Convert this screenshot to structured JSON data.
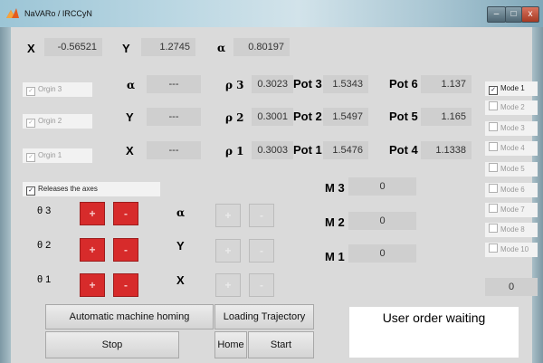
{
  "window": {
    "title": "NaVARo / IRCCyN",
    "minimize": "–",
    "maximize": "□",
    "close": "x"
  },
  "pose": {
    "x_label": "X",
    "x_value": "-0.56521",
    "y_label": "Y",
    "y_value": "1.2745",
    "a_label": "α",
    "a_value": "0.80197"
  },
  "origins": [
    "Orgin 3",
    "Orgin 2",
    "Orgin 1"
  ],
  "targets": [
    {
      "label": "α",
      "value": "---"
    },
    {
      "label": "Y",
      "value": "---"
    },
    {
      "label": "X",
      "value": "---"
    }
  ],
  "rhos": [
    {
      "label": "ρ 3",
      "value": "0.3023"
    },
    {
      "label": "ρ 2",
      "value": "0.3001"
    },
    {
      "label": "ρ 1",
      "value": "0.3003"
    }
  ],
  "pots_left": [
    {
      "label": "Pot 3",
      "value": "1.5343"
    },
    {
      "label": "Pot 2",
      "value": "1.5497"
    },
    {
      "label": "Pot 1",
      "value": "1.5476"
    }
  ],
  "pots_right": [
    {
      "label": "Pot 6",
      "value": "1.137"
    },
    {
      "label": "Pot 5",
      "value": "1.165"
    },
    {
      "label": "Pot 4",
      "value": "1.1338"
    }
  ],
  "release": {
    "label": "Releases the axes",
    "checked": "✓"
  },
  "thetas": [
    {
      "label": "θ 3",
      "axis": "α"
    },
    {
      "label": "θ 2",
      "axis": "Y"
    },
    {
      "label": "θ 1",
      "axis": "X"
    }
  ],
  "plus": "+",
  "minus": "-",
  "motors": [
    {
      "label": "M 3",
      "value": "0"
    },
    {
      "label": "M 2",
      "value": "0"
    },
    {
      "label": "M 1",
      "value": "0"
    }
  ],
  "modes": [
    "Mode 1",
    "Mode 2",
    "Mode 3",
    "Mode 4",
    "Mode 5",
    "Mode 6",
    "Mode 7",
    "Mode 8",
    "Mode 10"
  ],
  "mode_value": "0",
  "buttons": {
    "homing": "Automatic machine homing",
    "loading": "Loading Trajectory",
    "stop": "Stop",
    "home": "Home",
    "start": "Start"
  },
  "status": "User order waiting"
}
